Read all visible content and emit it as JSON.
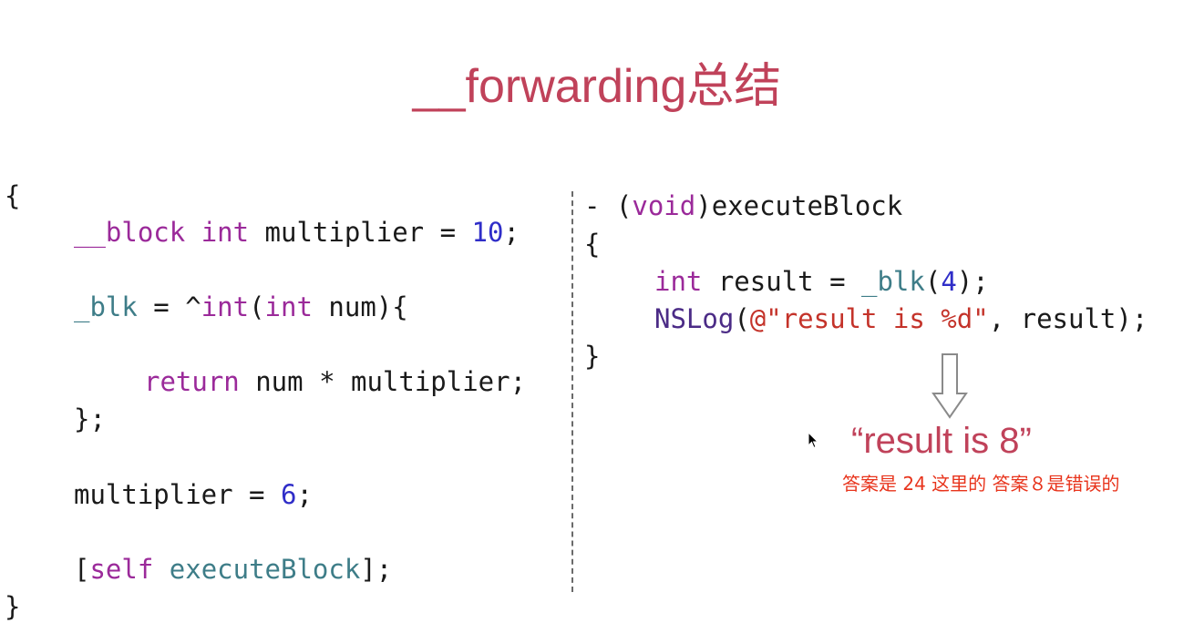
{
  "title": "__forwarding总结",
  "left_code": {
    "open_brace": "{",
    "block_kw": "__block",
    "int_kw": "int",
    "multiplier_decl": " multiplier = ",
    "ten": "10",
    "semi": ";",
    "blk_id": "_blk",
    "assign_caret": " = ^",
    "int_kw2": "int",
    "paren_open": "(",
    "int_kw3": "int",
    "num_brace": " num){",
    "return_kw": "return",
    "return_expr": " num * multiplier;",
    "close_inner": "};",
    "multiplier_assign": "multiplier = ",
    "six": "6",
    "semi2": ";",
    "bracket_open": "[",
    "self_kw": "self",
    "execute_call": " executeBlock",
    "bracket_close": "];",
    "close_brace": "}"
  },
  "right_code": {
    "dash": "- (",
    "void_kw": "void",
    "method_name": ")executeBlock",
    "open_brace": "{",
    "int_kw": "int",
    "result_assign": " result = ",
    "blk_id": "_blk",
    "paren_open": "(",
    "four": "4",
    "paren_close": ");",
    "nslog": "NSLog",
    "nslog_paren": "(",
    "fmt_string": "@\"result is %d\"",
    "nslog_rest": ", result);",
    "close_brace": "}"
  },
  "result_text": "“result is 8”",
  "annotation": "答案是 24 这里的 答案８是错误的",
  "colors": {
    "title": "#c0425a",
    "keyword": "#9b2a9a",
    "number": "#2f2dc8",
    "identifier": "#3e7d88",
    "string": "#c4332a",
    "annotation": "#e8341c"
  },
  "icons": {
    "arrow": "down-arrow-icon",
    "cursor": "mouse-cursor-icon"
  }
}
